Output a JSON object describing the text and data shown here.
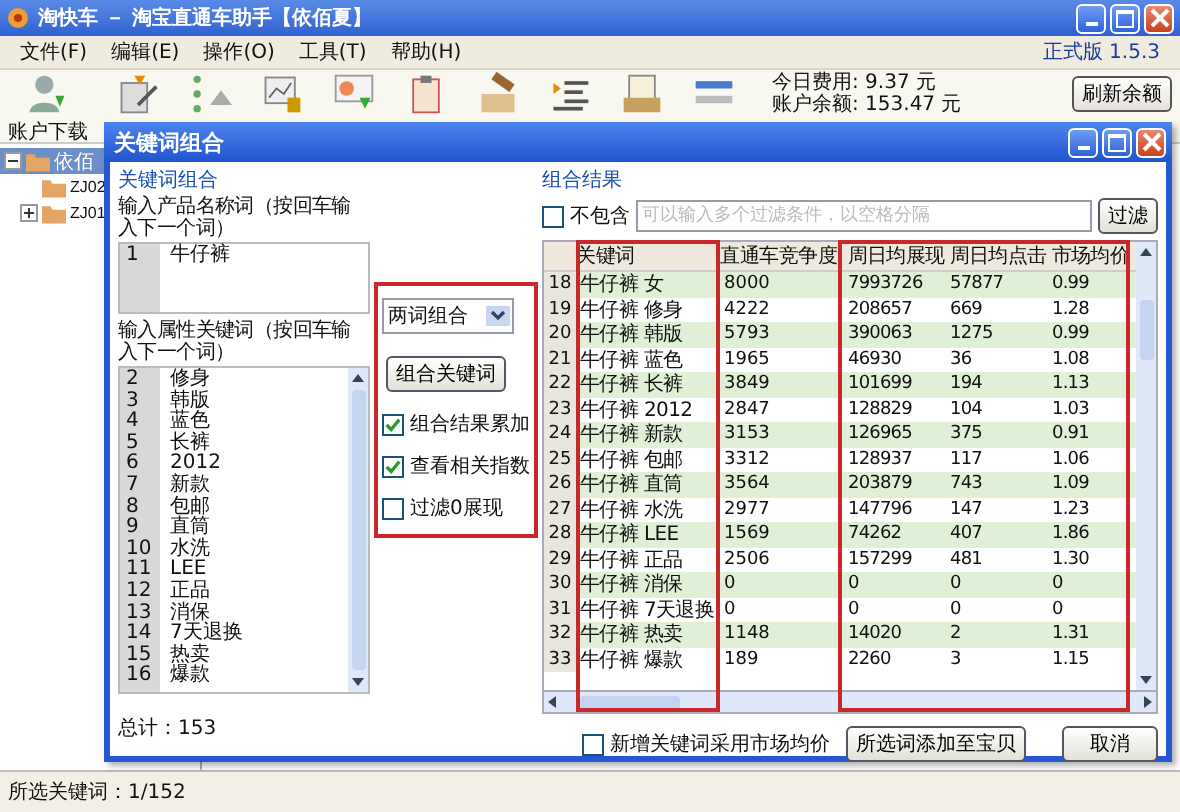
{
  "window": {
    "title": "淘快车 － 淘宝直通车助手【依佰夏】"
  },
  "menu": [
    "文件(F)",
    "编辑(E)",
    "操作(O)",
    "工具(T)",
    "帮助(H)"
  ],
  "version": "正式版 1.5.3",
  "toolbar": [
    "账户下载"
  ],
  "account": {
    "today_cost": "今日费用: 9.37 元",
    "balance": "账户余额: 153.47 元",
    "refresh_button": "刷新余额"
  },
  "tree": [
    {
      "label": "依佰",
      "kind": "group",
      "expanded": true,
      "selected": true,
      "children": [
        {
          "label": "ZJ02",
          "kind": "leaf",
          "selected": false
        },
        {
          "label": "ZJ01",
          "kind": "group",
          "expanded": false,
          "selected": false
        }
      ]
    }
  ],
  "dialog": {
    "title": "关键词组合",
    "left_group": {
      "title": "关键词组合",
      "product_label": "输入产品名称词（按回车输入下一个词）",
      "product_words": [
        {
          "line": "1",
          "text": "牛仔裤"
        }
      ],
      "attribute_label": "输入属性关键词（按回车输入下一个词）",
      "attribute_words": [
        {
          "line": "2",
          "text": "修身"
        },
        {
          "line": "3",
          "text": "韩版"
        },
        {
          "line": "4",
          "text": "蓝色"
        },
        {
          "line": "5",
          "text": "长裤"
        },
        {
          "line": "6",
          "text": "2012"
        },
        {
          "line": "7",
          "text": "新款"
        },
        {
          "line": "8",
          "text": "包邮"
        },
        {
          "line": "9",
          "text": "直筒"
        },
        {
          "line": "10",
          "text": "水洗"
        },
        {
          "line": "11",
          "text": "LEE"
        },
        {
          "line": "12",
          "text": "正品"
        },
        {
          "line": "13",
          "text": "消保"
        },
        {
          "line": "14",
          "text": "7天退换"
        },
        {
          "line": "15",
          "text": "热卖"
        },
        {
          "line": "16",
          "text": "爆款"
        }
      ],
      "total": "总计：153"
    },
    "options": {
      "mode": "两词组合",
      "combine_button": "组合关键词",
      "checkboxes": [
        {
          "label": "组合结果累加",
          "checked": true
        },
        {
          "label": "查看相关指数",
          "checked": true
        },
        {
          "label": "过滤0展现",
          "checked": false
        }
      ]
    },
    "result_group": {
      "title": "组合结果",
      "exclude": {
        "label": "不包含",
        "checked": false
      },
      "filter": {
        "placeholder": "可以输入多个过滤条件，以空格分隔"
      },
      "filter_button": "过滤",
      "table": {
        "columns": [
          "关键词",
          "直通车竞争度",
          "周日均展现",
          "周日均点击",
          "市场均价"
        ],
        "rows": [
          {
            "num": "18",
            "cells": [
              "牛仔裤 女",
              "8000",
              "7993726",
              "57877",
              "0.99"
            ]
          },
          {
            "num": "19",
            "cells": [
              "牛仔裤 修身",
              "4222",
              "208657",
              "669",
              "1.28"
            ]
          },
          {
            "num": "20",
            "cells": [
              "牛仔裤 韩版",
              "5793",
              "390063",
              "1275",
              "0.99"
            ]
          },
          {
            "num": "21",
            "cells": [
              "牛仔裤 蓝色",
              "1965",
              "46930",
              "36",
              "1.08"
            ]
          },
          {
            "num": "22",
            "cells": [
              "牛仔裤 长裤",
              "3849",
              "101699",
              "194",
              "1.13"
            ]
          },
          {
            "num": "23",
            "cells": [
              "牛仔裤 2012",
              "2847",
              "128829",
              "104",
              "1.03"
            ]
          },
          {
            "num": "24",
            "cells": [
              "牛仔裤 新款",
              "3153",
              "126965",
              "375",
              "0.91"
            ]
          },
          {
            "num": "25",
            "cells": [
              "牛仔裤 包邮",
              "3312",
              "128937",
              "117",
              "1.06"
            ]
          },
          {
            "num": "26",
            "cells": [
              "牛仔裤 直筒",
              "3564",
              "203879",
              "743",
              "1.09"
            ]
          },
          {
            "num": "27",
            "cells": [
              "牛仔裤 水洗",
              "2977",
              "147796",
              "147",
              "1.23"
            ]
          },
          {
            "num": "28",
            "cells": [
              "牛仔裤 LEE",
              "1569",
              "74262",
              "407",
              "1.86"
            ]
          },
          {
            "num": "29",
            "cells": [
              "牛仔裤 正品",
              "2506",
              "157299",
              "481",
              "1.30"
            ]
          },
          {
            "num": "30",
            "cells": [
              "牛仔裤 消保",
              "0",
              "0",
              "0",
              "0"
            ]
          },
          {
            "num": "31",
            "cells": [
              "牛仔裤 7天退换",
              "0",
              "0",
              "0",
              "0"
            ]
          },
          {
            "num": "32",
            "cells": [
              "牛仔裤 热卖",
              "1148",
              "14020",
              "2",
              "1.31"
            ]
          },
          {
            "num": "33",
            "cells": [
              "牛仔裤 爆款",
              "189",
              "2260",
              "3",
              "1.15"
            ]
          }
        ]
      }
    },
    "footer": {
      "checkbox": {
        "label": "新增关键词采用市场均价",
        "checked": false
      },
      "buttons": [
        "所选词添加至宝贝",
        "取消"
      ]
    }
  },
  "status_bar": "所选关键词：1/152"
}
